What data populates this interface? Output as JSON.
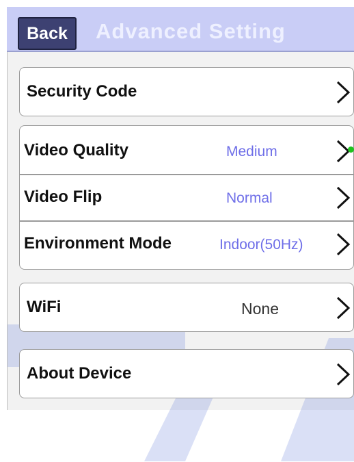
{
  "header": {
    "back_label": "Back",
    "title": "Advanced Setting"
  },
  "items": {
    "security_code": {
      "label": "Security Code"
    },
    "video_quality": {
      "label": "Video Quality",
      "value": "Medium"
    },
    "video_flip": {
      "label": "Video Flip",
      "value": "Normal"
    },
    "environment_mode": {
      "label": "Environment Mode",
      "value": "Indoor(50Hz)"
    },
    "wifi": {
      "label": "WiFi",
      "value": "None"
    },
    "about_device": {
      "label": "About Device"
    }
  },
  "colors": {
    "header_bg": "#c9cdf6",
    "back_button_bg": "#3d4172",
    "value_text": "#6e6ee8",
    "watermark": "#5b78d9"
  },
  "icons": {
    "row_chevron": "chevron-right-icon"
  }
}
